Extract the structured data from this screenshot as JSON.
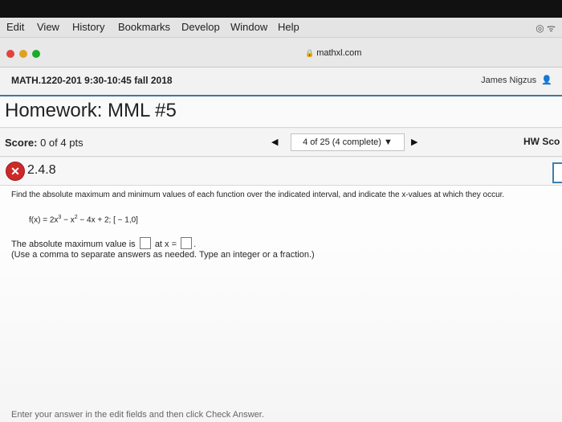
{
  "menubar": {
    "items": [
      "Edit",
      "View",
      "History",
      "Bookmarks",
      "Develop",
      "Window",
      "Help"
    ]
  },
  "browser": {
    "url": "mathxl.com"
  },
  "course": {
    "title": "MATH.1220-201 9:30-10:45 fall 2018",
    "user": "James Nigzus"
  },
  "homework": {
    "title": "Homework: MML #5"
  },
  "score": {
    "label": "Score:",
    "value": "0 of 4 pts",
    "nav_text": "4 of 25 (4 complete) ▼",
    "hw_score_label": "HW Sco"
  },
  "question": {
    "number": "2.4.8",
    "status": "incorrect",
    "prompt": "Find the absolute maximum and minimum values of each function over the indicated interval, and indicate the x-values at which they occur.",
    "formula_prefix": "f(x) = 2x",
    "formula_exp1": "3",
    "formula_mid": " − x",
    "formula_exp2": "2",
    "formula_suffix": " − 4x + 2; [ − 1,0]",
    "answer_pre": "The absolute maximum value is",
    "answer_mid": "at x =",
    "answer_end": ".",
    "instruction": "(Use a comma to separate answers as needed. Type an integer or a fraction.)",
    "footer": "Enter your answer in the edit fields and then click Check Answer."
  },
  "colors": {
    "accent": "#3c7a9e",
    "incorrect": "#cc2a2a"
  }
}
